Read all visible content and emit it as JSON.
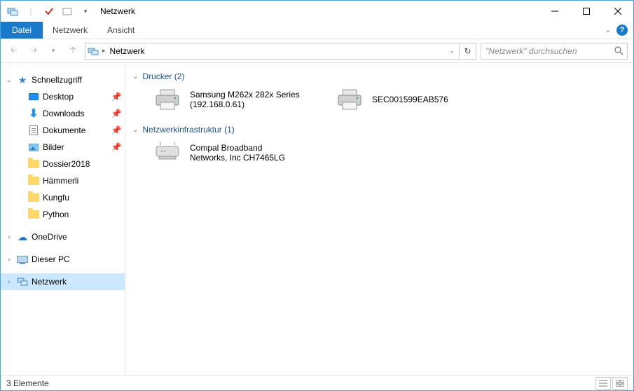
{
  "title": "Netzwerk",
  "ribbon": {
    "file": "Datei",
    "tabs": [
      "Netzwerk",
      "Ansicht"
    ]
  },
  "nav": {
    "address": "Netzwerk",
    "search_placeholder": "\"Netzwerk\" durchsuchen"
  },
  "tree": {
    "quick_access": "Schnellzugriff",
    "quick_items": [
      {
        "label": "Desktop",
        "icon": "desktop",
        "pinned": true
      },
      {
        "label": "Downloads",
        "icon": "downloads",
        "pinned": true
      },
      {
        "label": "Dokumente",
        "icon": "documents",
        "pinned": true
      },
      {
        "label": "Bilder",
        "icon": "pictures",
        "pinned": true
      },
      {
        "label": "Dossier2018",
        "icon": "folder",
        "pinned": false
      },
      {
        "label": "Hämmerli",
        "icon": "folder",
        "pinned": false
      },
      {
        "label": "Kungfu",
        "icon": "folder",
        "pinned": false
      },
      {
        "label": "Python",
        "icon": "folder",
        "pinned": false
      }
    ],
    "onedrive": "OneDrive",
    "this_pc": "Dieser PC",
    "network": "Netzwerk"
  },
  "content": {
    "groups": [
      {
        "title": "Drucker (2)",
        "items": [
          {
            "name": "Samsung M262x 282x Series",
            "subtitle": "(192.168.0.61)",
            "icon": "printer"
          },
          {
            "name": "SEC001599EAB576",
            "subtitle": "",
            "icon": "printer"
          }
        ]
      },
      {
        "title": "Netzwerkinfrastruktur (1)",
        "items": [
          {
            "name": "Compal Broadband",
            "subtitle": "Networks, Inc CH7465LG",
            "icon": "router"
          }
        ]
      }
    ]
  },
  "status": {
    "count_text": "3 Elemente"
  }
}
